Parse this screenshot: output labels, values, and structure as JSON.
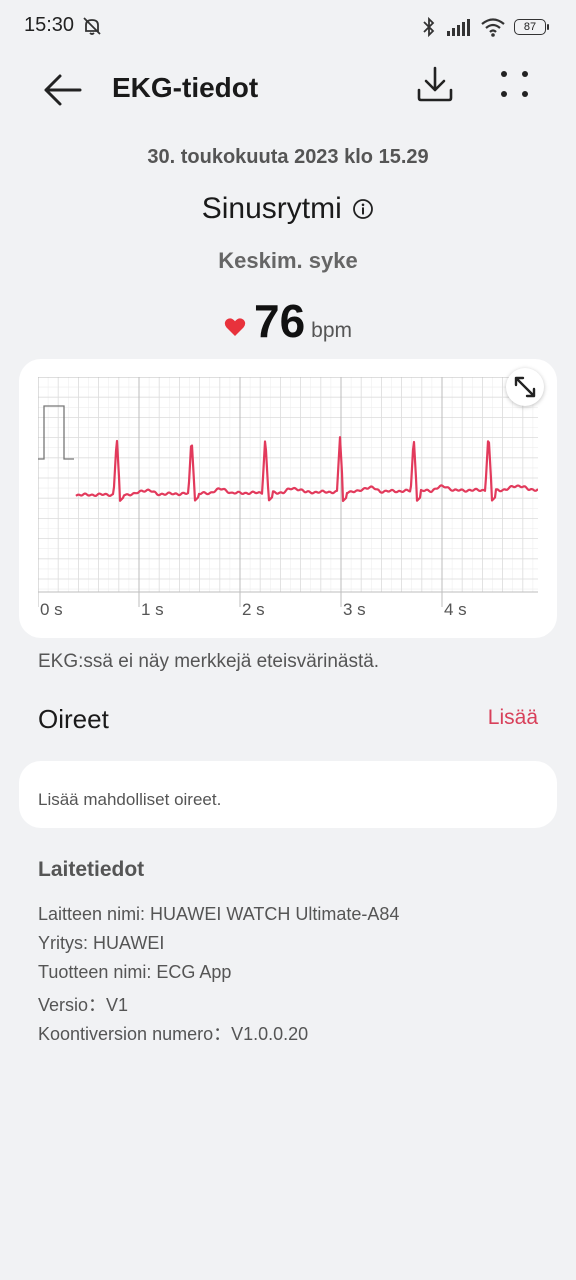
{
  "status_bar": {
    "time": "15:30",
    "battery": "87"
  },
  "header": {
    "title": "EKG-tiedot"
  },
  "summary": {
    "date": "30. toukokuuta 2023 klo 15.29",
    "rhythm": "Sinusrytmi",
    "avg_label": "Keskim. syke",
    "bpm_value": "76",
    "bpm_unit": "bpm"
  },
  "chart_data": {
    "type": "line",
    "xlabel": "",
    "ylabel": "",
    "x_ticks": [
      "0 s",
      "1 s",
      "2 s",
      "3 s",
      "4 s"
    ],
    "xlim": [
      0,
      5
    ],
    "line_color": "#e23a5c",
    "beat_times_s": [
      0.78,
      1.52,
      2.25,
      2.99,
      3.72,
      4.46
    ],
    "grid": true
  },
  "ecg_result": "EKG:ssä ei näy merkkejä eteisvärinästä.",
  "symptoms": {
    "title": "Oireet",
    "add_label": "Lisää",
    "placeholder": "Lisää mahdolliset oireet."
  },
  "device": {
    "title": "Laitetiedot",
    "lines": [
      "Laitteen nimi: HUAWEI WATCH Ultimate-A84",
      "Yritys: HUAWEI",
      "Tuotteen nimi: ECG App",
      "Versio：V1",
      "Koontiversion numero：V1.0.0.20"
    ]
  },
  "colors": {
    "accent": "#d8405a",
    "heart": "#e8323c",
    "background": "#f1f2f4"
  }
}
